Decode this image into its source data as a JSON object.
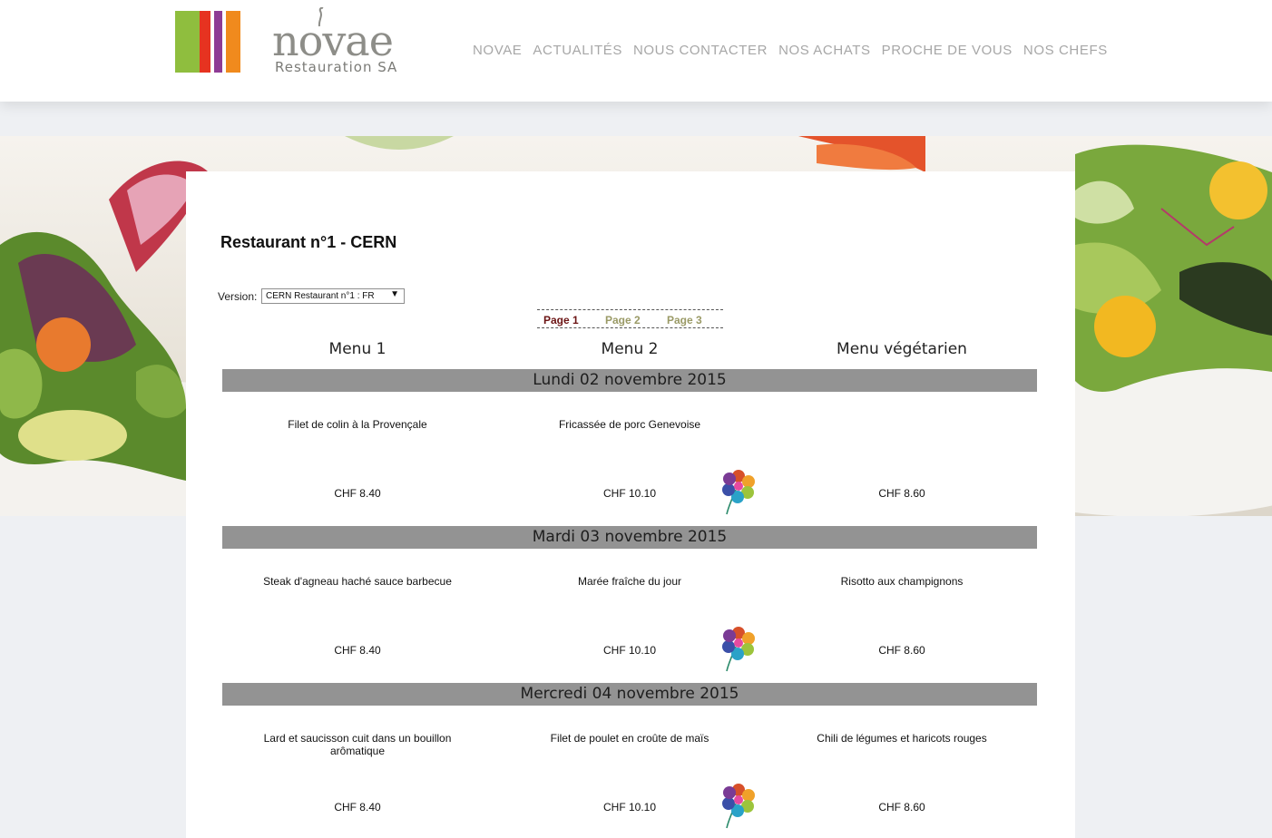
{
  "brand": {
    "name": "novae",
    "subtitle": "Restauration SA",
    "bar_colors": [
      "#8fbe3e",
      "#e63320",
      "#8e3b95",
      "#f08a1d"
    ]
  },
  "nav": {
    "items": [
      "NOVAE",
      "ACTUALITÉS",
      "NOUS CONTACTER",
      "NOS ACHATS",
      "PROCHE DE VOUS",
      "NOS CHEFS"
    ]
  },
  "page": {
    "title": "Restaurant n°1 - CERN",
    "version_label": "Version:",
    "version_selected": "CERN Restaurant n°1 : FR"
  },
  "pager": {
    "pages": [
      {
        "label": "Page 1",
        "active": true
      },
      {
        "label": "Page 2",
        "active": false
      },
      {
        "label": "Page 3",
        "active": false
      }
    ]
  },
  "columns": [
    "Menu 1",
    "Menu 2",
    "Menu végétarien"
  ],
  "days": [
    {
      "date": "Lundi 02 novembre 2015",
      "dishes": [
        "Filet de colin à la Provençale",
        "Fricassée de porc Genevoise",
        ""
      ],
      "prices": [
        "CHF 8.40",
        "CHF 10.10",
        "CHF 8.60"
      ]
    },
    {
      "date": "Mardi 03 novembre 2015",
      "dishes": [
        "Steak d'agneau haché sauce barbecue",
        "Marée fraîche du jour",
        "Risotto aux champignons"
      ],
      "prices": [
        "CHF 8.40",
        "CHF 10.10",
        "CHF 8.60"
      ]
    },
    {
      "date": "Mercredi 04 novembre 2015",
      "dishes": [
        "Lard et saucisson cuit dans un bouillon arômatique",
        "Filet de poulet en croûte de maïs",
        "Chili de légumes et haricots rouges"
      ],
      "prices": [
        "CHF 8.40",
        "CHF 10.10",
        "CHF 8.60"
      ]
    }
  ],
  "icons": {
    "label_icon": "flower-label-icon",
    "dropdown": "dropdown-arrow-icon"
  },
  "colors": {
    "pager_active": "#6b1414",
    "pager_inactive": "#9a9a66",
    "day_bar": "#939393",
    "nav_text": "#a7a7a7"
  }
}
